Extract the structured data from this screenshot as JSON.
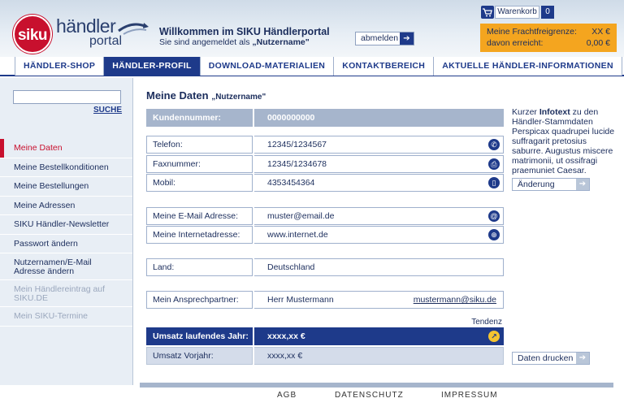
{
  "header": {
    "logo_siku": "siku",
    "logo_haendler": "händler",
    "logo_portal": "portal",
    "welcome": "Willkommen im SIKU Händlerportal",
    "logged_in_prefix": "Sie sind angemeldet als ",
    "username": "„Nutzername\"",
    "logout_label": "abmelden",
    "cart_label": "Warenkorb",
    "cart_count": "0",
    "freight_label": "Meine Frachtfreigrenze:",
    "freight_value": "XX €",
    "reached_label": "davon erreicht:",
    "reached_value": "0,00 €"
  },
  "nav": {
    "tabs": [
      {
        "label": "HÄNDLER-SHOP"
      },
      {
        "label": "HÄNDLER-PROFIL"
      },
      {
        "label": "DOWNLOAD-MATERIALIEN"
      },
      {
        "label": "KONTAKTBEREICH"
      },
      {
        "label": "AKTUELLE HÄNDLER-INFORMATIONEN"
      }
    ]
  },
  "sidebar": {
    "search_value": "",
    "search_link": "SUCHE",
    "items": [
      {
        "label": "Meine Daten"
      },
      {
        "label": "Meine Bestellkonditionen"
      },
      {
        "label": "Meine Bestellungen"
      },
      {
        "label": "Meine Adressen"
      },
      {
        "label": "SIKU Händler-Newsletter"
      },
      {
        "label": "Passwort ändern"
      },
      {
        "line1": "Nutzernamen/E-Mail",
        "line2": "Adresse  ändern"
      },
      {
        "line1": "Mein Händlereintrag auf",
        "line2": "SIKU.DE"
      },
      {
        "label": "Mein SIKU-Termine"
      }
    ]
  },
  "main": {
    "title": "Meine Daten",
    "title_user": "„Nutzername\"",
    "customer_label": "Kundennummer:",
    "customer_value": "0000000000",
    "phone_label": "Telefon:",
    "phone_value": "12345/1234567",
    "fax_label": "Faxnummer:",
    "fax_value": "12345/1234678",
    "mobile_label": "Mobil:",
    "mobile_value": "4353454364",
    "email_label": "Meine E-Mail Adresse:",
    "email_value": "muster@email.de",
    "web_label": "Meine Internetadresse:",
    "web_value": "www.internet.de",
    "country_label": "Land:",
    "country_value": "Deutschland",
    "contact_label": "Mein Ansprechpartner:",
    "contact_value": "Herr Mustermann",
    "contact_email": "mustermann@siku.de",
    "tendenz": "Tendenz",
    "sales_current_label": "Umsatz laufendes Jahr:",
    "sales_current_value": "xxxx,xx €",
    "sales_prev_label": "Umsatz Vorjahr:",
    "sales_prev_value": "xxxx,xx €"
  },
  "info": {
    "prefix": "Kurzer ",
    "bold": "Infotext",
    "text": " zu den Händler-Stammdaten Perspicax quadrupei lucide suffragarit pretosius saburre. Augustus miscere matrimonii, ut ossifragi praemuniet Caesar.",
    "change_button": "Änderung",
    "print_button": "Daten drucken"
  },
  "footer": {
    "links": [
      "AGB",
      "DATENSCHUTZ",
      "IMPRESSUM"
    ]
  }
}
